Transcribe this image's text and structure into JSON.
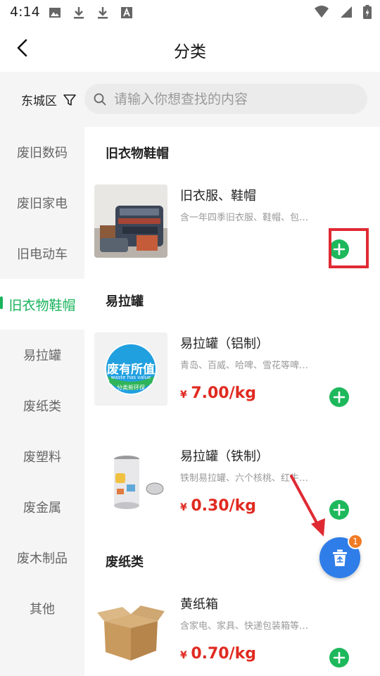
{
  "status_bar": {
    "time": "4:14"
  },
  "header": {
    "title": "分类"
  },
  "search": {
    "district": "东城区",
    "placeholder": "请输入你想查找的内容"
  },
  "sidebar": {
    "items": [
      {
        "label": "废旧数码",
        "active": false
      },
      {
        "label": "废旧家电",
        "active": false
      },
      {
        "label": "旧电动车",
        "active": false
      },
      {
        "label": "旧衣物鞋帽",
        "active": true
      },
      {
        "label": "易拉罐",
        "active": false
      },
      {
        "label": "废纸类",
        "active": false
      },
      {
        "label": "废塑料",
        "active": false
      },
      {
        "label": "废金属",
        "active": false
      },
      {
        "label": "废木制品",
        "active": false
      },
      {
        "label": "其他",
        "active": false
      }
    ]
  },
  "sections": {
    "clothes": {
      "title": "旧衣物鞋帽",
      "items": [
        {
          "name": "旧衣服、鞋帽",
          "desc": "含一年四季旧衣服、鞋帽、包…",
          "price_symbol": "",
          "price": ""
        }
      ]
    },
    "cans": {
      "title": "易拉罐",
      "items": [
        {
          "name": "易拉罐（铝制）",
          "desc": "青岛、百威、哈啤、雪花等啤…",
          "price_symbol": "¥",
          "price": "7.00/kg",
          "logo_text": "废有所值",
          "logo_sub": "waste has value",
          "logo_bottom": "分类新环保"
        },
        {
          "name": "易拉罐（铁制）",
          "desc": "铁制易拉罐、六个核桃、红牛…",
          "price_symbol": "¥",
          "price": "0.30/kg"
        }
      ]
    },
    "paper": {
      "title": "废纸类",
      "items": [
        {
          "name": "黄纸箱",
          "desc": "含家电、家具、快递包装箱等…",
          "price_symbol": "¥",
          "price": "0.70/kg"
        }
      ]
    }
  },
  "cart": {
    "badge": "1"
  },
  "colors": {
    "accent": "#19b35c",
    "add_button": "#1eb85c",
    "price": "#e02a20",
    "fab": "#2f7de8",
    "badge": "#f07b24",
    "highlight": "#e02a33"
  }
}
